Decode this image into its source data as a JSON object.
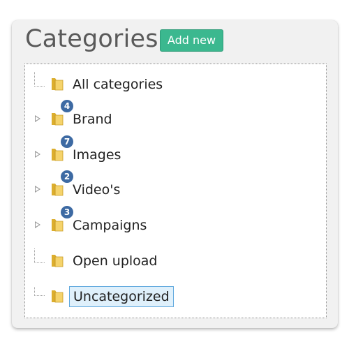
{
  "header": {
    "title": "Categories",
    "add_label": "Add new",
    "accent_color": "#3bb88f"
  },
  "tree": {
    "selected_item": "Uncategorized",
    "badge_color": "#3d6aa3",
    "folder_color": "#f2c94c",
    "items": [
      {
        "label": "All categories",
        "badge": "",
        "expandable": false,
        "icon": "folder-icon"
      },
      {
        "label": "Brand",
        "badge": "4",
        "expandable": true,
        "icon": "folder-icon"
      },
      {
        "label": "Images",
        "badge": "7",
        "expandable": true,
        "icon": "folder-icon"
      },
      {
        "label": "Video's",
        "badge": "2",
        "expandable": true,
        "icon": "folder-icon"
      },
      {
        "label": "Campaigns",
        "badge": "3",
        "expandable": true,
        "icon": "folder-icon"
      },
      {
        "label": "Open upload",
        "badge": "",
        "expandable": false,
        "icon": "folder-icon"
      },
      {
        "label": "Uncategorized",
        "badge": "",
        "expandable": false,
        "icon": "folder-icon"
      }
    ]
  }
}
